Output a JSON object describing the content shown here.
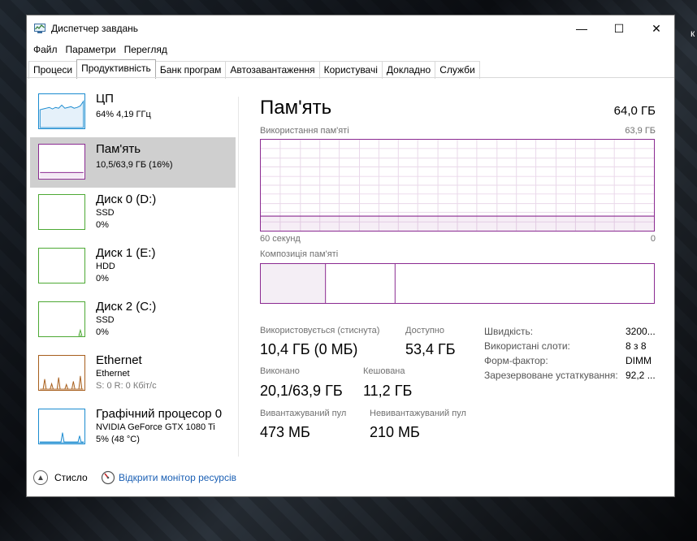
{
  "window": {
    "title": "Диспетчер завдань",
    "controls": {
      "minimize": "—",
      "maximize": "☐",
      "close": "✕"
    }
  },
  "menu": [
    "Файл",
    "Параметри",
    "Перегляд"
  ],
  "tabs": [
    "Процеси",
    "Продуктивність",
    "Банк програм",
    "Автозавантаження",
    "Користувачі",
    "Докладно",
    "Служби"
  ],
  "active_tab": "Продуктивність",
  "sidebar": [
    {
      "name": "ЦП",
      "sub1": "64% 4,19 ГГц",
      "color": "#1a8bd0"
    },
    {
      "name": "Пам'ять",
      "sub1": "10,5/63,9 ГБ (16%)",
      "color": "#8b2a91"
    },
    {
      "name": "Диск 0 (D:)",
      "sub1": "SSD",
      "sub2": "0%",
      "color": "#4da934"
    },
    {
      "name": "Диск 1 (E:)",
      "sub1": "HDD",
      "sub2": "0%",
      "color": "#4da934"
    },
    {
      "name": "Диск 2 (C:)",
      "sub1": "SSD",
      "sub2": "0%",
      "color": "#4da934"
    },
    {
      "name": "Ethernet",
      "sub1": "Ethernet",
      "sub2": "S: 0 R: 0 Кбіт/с",
      "color": "#a75e1c"
    },
    {
      "name": "Графічний процесор 0",
      "sub1": "NVIDIA GeForce GTX 1080 Ti",
      "sub2": "5% (48 °C)",
      "color": "#1a8bd0"
    }
  ],
  "main": {
    "title": "Пам'ять",
    "total": "64,0 ГБ",
    "usage_label": "Використання пам'яті",
    "usage_max": "63,9 ГБ",
    "time_left": "60 секунд",
    "time_right": "0",
    "composition_label": "Композиція пам'яті",
    "usage_fraction": 0.16,
    "stats": {
      "in_use_label": "Використовується (стиснута)",
      "in_use_value": "10,4 ГБ (0 МБ)",
      "available_label": "Доступно",
      "available_value": "53,4 ГБ",
      "committed_label": "Виконано",
      "committed_value": "20,1/63,9 ГБ",
      "cached_label": "Кешована",
      "cached_value": "11,2 ГБ",
      "paged_label": "Вивантажуваний пул",
      "paged_value": "473 МБ",
      "nonpaged_label": "Невивантажуваний пул",
      "nonpaged_value": "210 МБ"
    },
    "details": [
      {
        "key": "Швидкість:",
        "value": "3200..."
      },
      {
        "key": "Використані слоти:",
        "value": "8 з 8"
      },
      {
        "key": "Форм-фактор:",
        "value": "DIMM"
      },
      {
        "key": "Зарезервоване устаткування:",
        "value": "92,2 ..."
      }
    ]
  },
  "footer": {
    "fewer_details": "Стисло",
    "resource_monitor": "Відкрити монітор ресурсів"
  },
  "desktop_char": "к"
}
